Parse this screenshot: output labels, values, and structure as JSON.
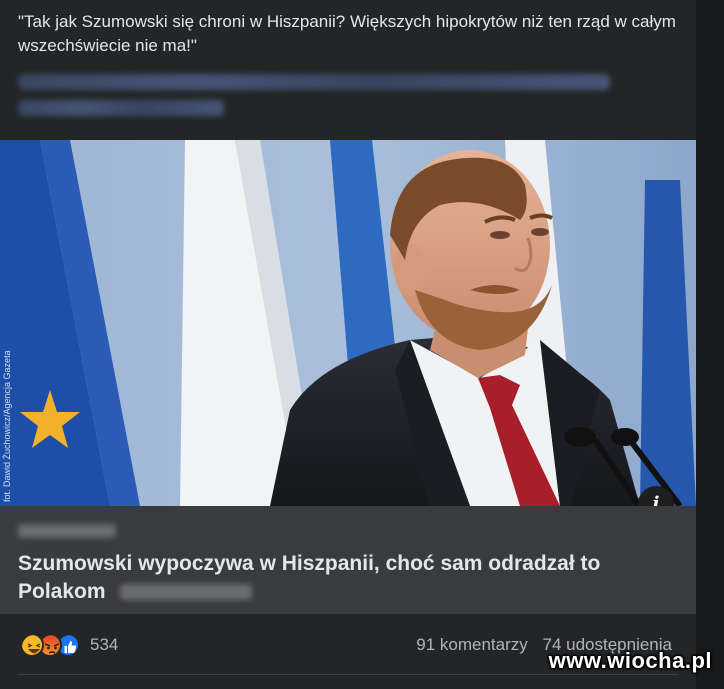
{
  "post": {
    "text": "\"Tak jak Szumowski się chroni w Hiszpanii? Większych hipokrytów niż ten rząd w całym wszechświecie nie ma!\""
  },
  "photo": {
    "credit": "fot. Dawid Żuchowicz/Agencja Gazeta",
    "info_icon": "i"
  },
  "link_preview": {
    "title": "Szumowski wypoczywa w Hiszpanii, choć sam odradzał to Polakom"
  },
  "footer": {
    "reaction_icons": [
      "haha-icon",
      "angry-icon",
      "like-icon"
    ],
    "reaction_count": "534",
    "comments": "91 komentarzy",
    "shares": "74 udostępnienia"
  },
  "watermark": "www.wiocha.pl",
  "colors": {
    "background": "#242526",
    "link_area": "#3a3b3c",
    "text_primary": "#e4e6eb",
    "text_secondary": "#b0b3b8",
    "like_blue": "#1877f2",
    "haha_yellow": "#f7b928",
    "angry_red": "#e9710f"
  }
}
